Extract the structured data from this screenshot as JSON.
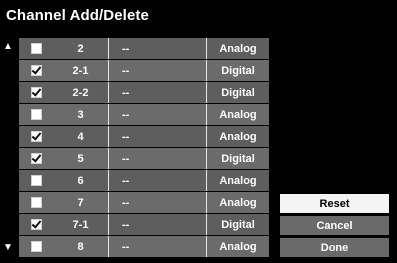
{
  "title": "Channel Add/Delete",
  "scroll": {
    "up_icon": "triangle-up",
    "down_icon": "triangle-down"
  },
  "channels": [
    {
      "checked": false,
      "number": "2",
      "name": "--",
      "type": "Analog"
    },
    {
      "checked": true,
      "number": "2-1",
      "name": "--",
      "type": "Digital"
    },
    {
      "checked": true,
      "number": "2-2",
      "name": "--",
      "type": "Digital"
    },
    {
      "checked": false,
      "number": "3",
      "name": "--",
      "type": "Analog"
    },
    {
      "checked": true,
      "number": "4",
      "name": "--",
      "type": "Analog"
    },
    {
      "checked": true,
      "number": "5",
      "name": "--",
      "type": "Digital"
    },
    {
      "checked": false,
      "number": "6",
      "name": "--",
      "type": "Analog"
    },
    {
      "checked": false,
      "number": "7",
      "name": "--",
      "type": "Analog"
    },
    {
      "checked": true,
      "number": "7-1",
      "name": "--",
      "type": "Digital"
    },
    {
      "checked": false,
      "number": "8",
      "name": "--",
      "type": "Analog"
    }
  ],
  "buttons": {
    "reset": {
      "label": "Reset",
      "selected": true
    },
    "cancel": {
      "label": "Cancel",
      "selected": false
    },
    "done": {
      "label": "Done",
      "selected": false
    }
  },
  "colors": {
    "background": "#000000",
    "row": "#5e5e5e",
    "row_alt": "#6b6b6b",
    "button": "#6a6a6a",
    "button_selected": "#f4f4f4"
  }
}
